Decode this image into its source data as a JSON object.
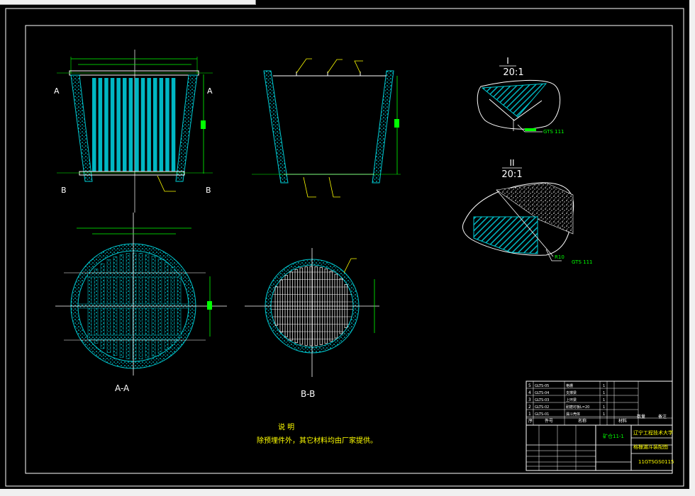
{
  "drawing": {
    "section_labels": {
      "a_left": "A",
      "a_right": "A",
      "b_left": "B",
      "b_right": "B",
      "aa_view": "A-A",
      "bb_view": "B-B"
    },
    "detail_views": [
      {
        "roman": "I",
        "scale": "20:1",
        "tag": "GTS 111"
      },
      {
        "roman": "II",
        "scale": "20:1",
        "tag": "GTS 111",
        "dim": "R10"
      }
    ],
    "notes": {
      "heading": "说  明",
      "body": "除预埋件外，其它材料均由厂家提供。"
    }
  },
  "title_block": {
    "parts": [
      {
        "no": "5",
        "code": "GLTS-05",
        "name": "格栅",
        "qty": "1"
      },
      {
        "no": "4",
        "code": "GLTS-04",
        "name": "支撑梁",
        "qty": "1"
      },
      {
        "no": "3",
        "code": "GLTS-03",
        "name": "上环梁",
        "qty": "1"
      },
      {
        "no": "2",
        "code": "GLTS-02",
        "name": "耐磨衬板L=20",
        "qty": "1"
      },
      {
        "no": "1",
        "code": "GLTS-01",
        "name": "漏斗壳体",
        "qty": "1"
      }
    ],
    "header": {
      "no": "序",
      "code": "件号",
      "name": "名称",
      "qty": "数量",
      "material": "材料",
      "remark": "备注"
    },
    "drawing_title": "矿仓11-1",
    "school": "辽宁工程技术大学",
    "drawing_name": "格栅漏斗装配图",
    "drawing_code": "11GTSGS0115"
  },
  "colors": {
    "background": "#000000",
    "frame": "#ffffff",
    "dimension": "#00ff00",
    "hatch": "#00b7c3",
    "note_text": "#ffff00",
    "leader": "#ffff00"
  }
}
